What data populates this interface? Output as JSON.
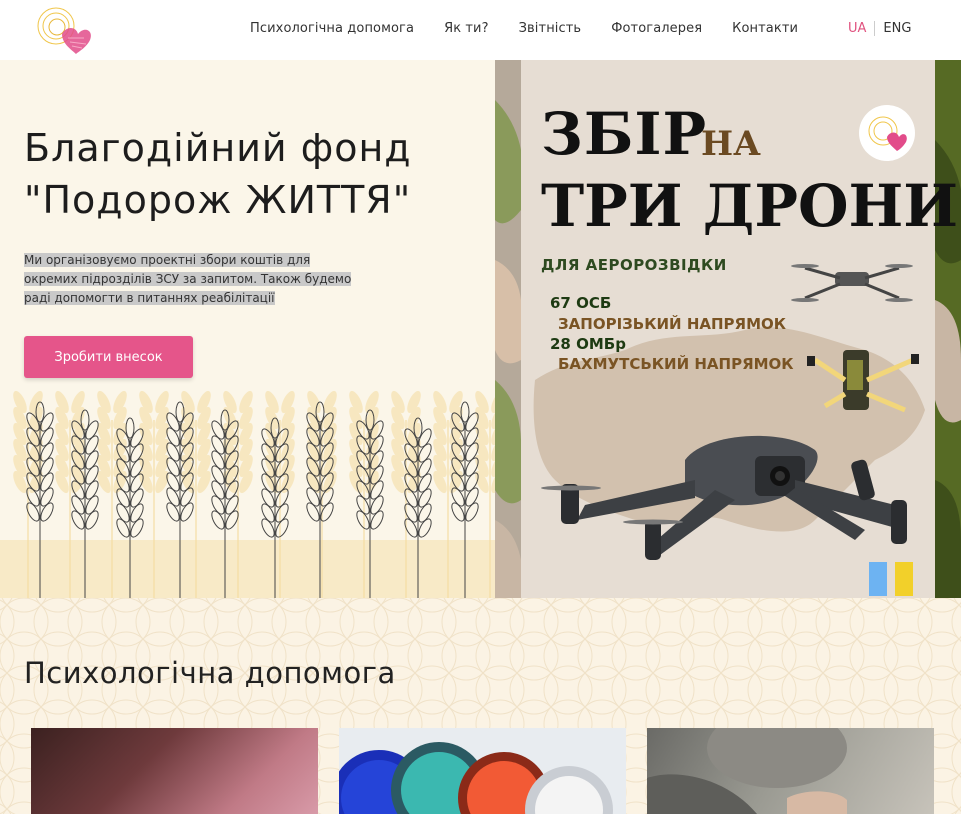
{
  "header": {
    "nav": [
      "Психологічна допомога",
      "Як ти?",
      "Звітність",
      "Фотогалерея",
      "Контакти"
    ],
    "lang_ua": "UA",
    "lang_en": "ENG"
  },
  "hero": {
    "title_line1": "Благодійний фонд",
    "title_line2": "\"Подорож ЖИТТЯ\"",
    "desc_line1": "Ми організовуємо проектні збори коштів для",
    "desc_line2": "окремих підрозділів ЗСУ за запитом. Також будемо",
    "desc_line3": "раді допомогти в питаннях реабілітації",
    "cta": "Зробити внесок"
  },
  "poster": {
    "title_zbir": "ЗБІР",
    "title_na": "НА",
    "title_drones": "ТРИ ДРОНИ",
    "subtitle": "ДЛЯ АЕРОРОЗВІДКИ",
    "line1": "67 ОСБ",
    "line2": "ЗАПОРІЗЬКИЙ НАПРЯМОК",
    "line3": "28 ОМБр",
    "line4": "БАХМУТСЬКИЙ НАПРЯМОК"
  },
  "section": {
    "title": "Психологічна допомога"
  },
  "colors": {
    "accent": "#e5558a",
    "hero_bg": "#fbf6e9",
    "section_bg": "#fbf3e4"
  }
}
